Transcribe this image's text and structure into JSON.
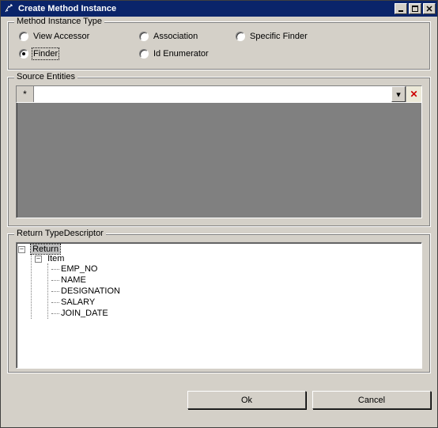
{
  "window": {
    "title": "Create Method Instance",
    "min": "_",
    "max": "□",
    "close": "×"
  },
  "method_instance_type": {
    "legend": "Method Instance Type",
    "options": [
      {
        "key": "view_accessor",
        "label": "View Accessor",
        "checked": false
      },
      {
        "key": "association",
        "label": "Association",
        "checked": false
      },
      {
        "key": "specific_finder",
        "label": "Specific Finder",
        "checked": false
      },
      {
        "key": "finder",
        "label": "Finder",
        "checked": true
      },
      {
        "key": "id_enumerator",
        "label": "Id Enumerator",
        "checked": false
      }
    ]
  },
  "source_entities": {
    "legend": "Source Entities",
    "new_row_marker": "*",
    "dropdown_glyph": "▾",
    "delete_glyph": "✕"
  },
  "return_type_descriptor": {
    "legend": "Return TypeDescriptor",
    "root": "Return",
    "child": "Item",
    "fields": [
      "EMP_NO",
      "NAME",
      "DESIGNATION",
      "SALARY",
      "JOIN_DATE"
    ],
    "expander": "–"
  },
  "buttons": {
    "ok": "Ok",
    "cancel": "Cancel"
  }
}
